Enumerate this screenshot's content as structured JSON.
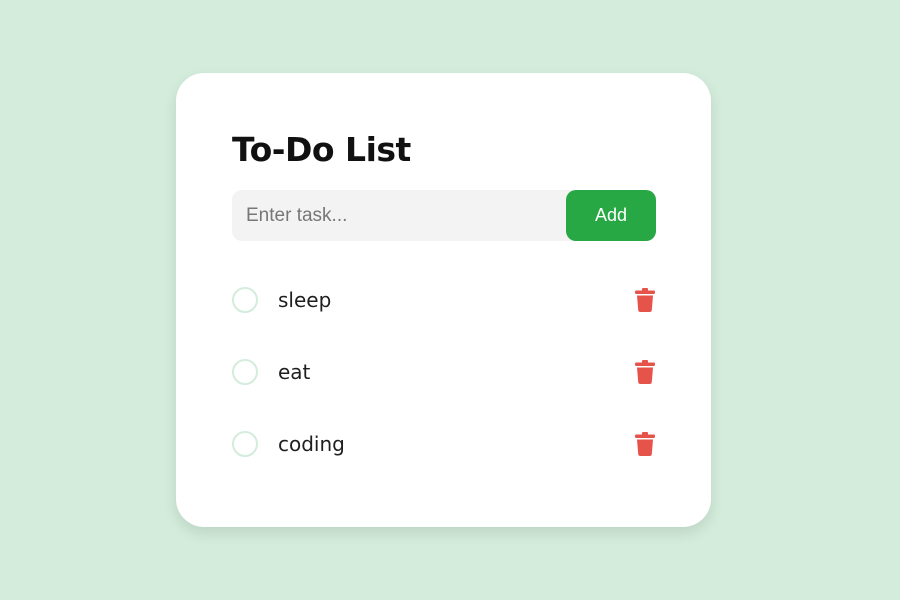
{
  "app": {
    "title": "To-Do List"
  },
  "input": {
    "placeholder": "Enter task...",
    "value": ""
  },
  "add_button": {
    "label": "Add"
  },
  "tasks": [
    {
      "text": "sleep",
      "completed": false
    },
    {
      "text": "eat",
      "completed": false
    },
    {
      "text": "coding",
      "completed": false
    }
  ],
  "icons": {
    "task_check": "circle-outline-icon",
    "task_delete": "trash-icon"
  },
  "colors": {
    "background": "#d3ecdb",
    "card": "#ffffff",
    "accent": "#28a745",
    "delete": "#e5534b",
    "input_background": "#f3f3f3"
  }
}
